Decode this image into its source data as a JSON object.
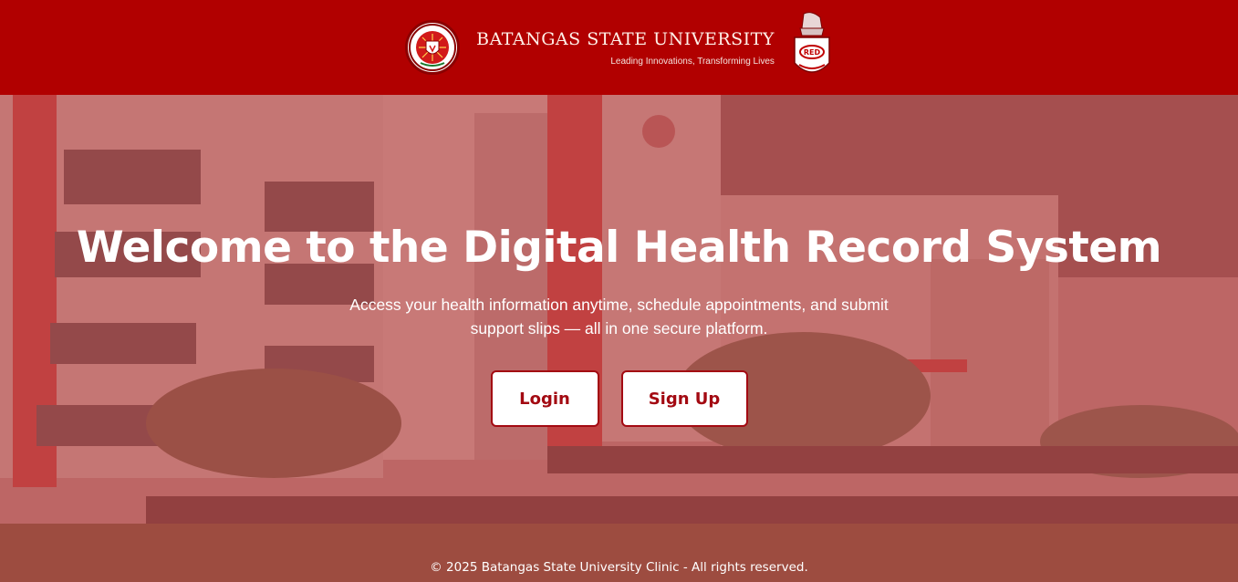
{
  "header": {
    "university_name": "BATANGAS STATE UNIVERSITY",
    "tagline": "Leading Innovations, Transforming Lives",
    "seal_icon": "university-seal-icon",
    "mascot_icon": "red-spartan-mascot-icon"
  },
  "hero": {
    "title": "Welcome to the Digital Health Record System",
    "subtitle": "Access your health information anytime, schedule appointments, and submit support slips — all in one secure platform.",
    "login_label": "Login",
    "signup_label": "Sign Up"
  },
  "footer": {
    "copyright": "© 2025 Batangas State University Clinic - All rights reserved."
  },
  "colors": {
    "header_bg": "#b10000",
    "overlay": "#b02828",
    "button_text": "#a30a12"
  }
}
